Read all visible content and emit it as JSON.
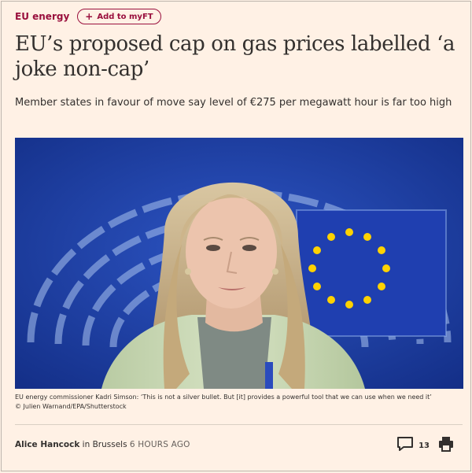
{
  "topic": {
    "label": "EU energy"
  },
  "myft": {
    "plus": "+",
    "label": "Add to myFT"
  },
  "article": {
    "headline": "EU’s proposed cap on gas prices labelled ‘a joke non-cap’",
    "standfirst": "Member states in favour of move say level of €275 per megawatt hour is far too high",
    "caption_text": "EU energy commissioner Kadri Simson: ‘This is not a silver bullet. But [it] provides a powerful tool that we can use when we need it’",
    "caption_credit": "© Julien Warnand/EPA/Shutterstock"
  },
  "byline": {
    "author": "Alice Hancock",
    "in_text": " in ",
    "location": "Brussels",
    "time": "6 HOURS AGO"
  },
  "tools": {
    "comment_count": "13",
    "comment_icon": "comment-icon",
    "print_icon": "print-icon"
  },
  "colors": {
    "background": "#fff1e5",
    "brand_claret": "#990f3d",
    "text": "#33302e",
    "hero_blue": "#2141a8"
  }
}
